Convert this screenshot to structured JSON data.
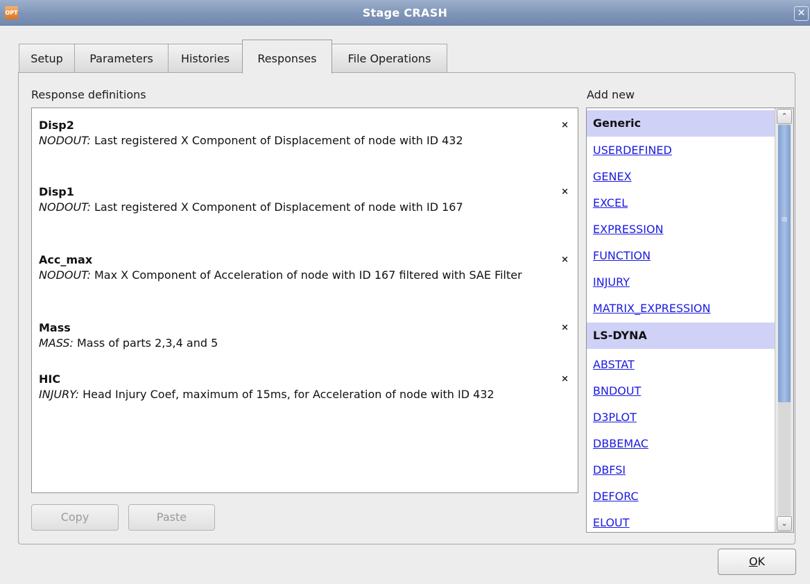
{
  "window": {
    "title": "Stage CRASH",
    "app_icon_text": "OPT",
    "close_symbol": "✕"
  },
  "tabs": [
    {
      "label": "Setup",
      "active": false
    },
    {
      "label": "Parameters",
      "active": false
    },
    {
      "label": "Histories",
      "active": false
    },
    {
      "label": "Responses",
      "active": true
    },
    {
      "label": "File Operations",
      "active": false
    }
  ],
  "responses": {
    "label": "Response definitions",
    "delete_symbol": "×",
    "items": [
      {
        "name": "Disp2",
        "source": "NODOUT:",
        "description": "Last registered X Component of Displacement of node with ID 432"
      },
      {
        "name": "Disp1",
        "source": "NODOUT:",
        "description": "Last registered X Component of Displacement of node with ID 167"
      },
      {
        "name": "Acc_max",
        "source": "NODOUT:",
        "description": "Max X Component of Acceleration of node with ID 167 filtered with SAE Filter"
      },
      {
        "name": "Mass",
        "source": "MASS:",
        "description": "Mass of parts 2,3,4 and 5"
      },
      {
        "name": "HIC",
        "source": "INJURY:",
        "description": "Head Injury Coef, maximum of 15ms, for Acceleration of node with ID 432"
      }
    ],
    "copy_label": "Copy",
    "paste_label": "Paste"
  },
  "add_new": {
    "label": "Add new",
    "rows": [
      {
        "text": "Generic",
        "kind": "header"
      },
      {
        "text": "USERDEFINED",
        "kind": "link"
      },
      {
        "text": "GENEX",
        "kind": "link"
      },
      {
        "text": "EXCEL",
        "kind": "link"
      },
      {
        "text": "EXPRESSION",
        "kind": "link"
      },
      {
        "text": "FUNCTION",
        "kind": "link"
      },
      {
        "text": "INJURY",
        "kind": "link"
      },
      {
        "text": "MATRIX_EXPRESSION",
        "kind": "link"
      },
      {
        "text": "LS-DYNA",
        "kind": "header"
      },
      {
        "text": "ABSTAT",
        "kind": "link"
      },
      {
        "text": "BNDOUT",
        "kind": "link"
      },
      {
        "text": "D3PLOT",
        "kind": "link"
      },
      {
        "text": "DBBEMAC",
        "kind": "link"
      },
      {
        "text": "DBFSI",
        "kind": "link"
      },
      {
        "text": "DEFORC",
        "kind": "link"
      },
      {
        "text": "ELOUT",
        "kind": "link"
      }
    ],
    "scroll": {
      "up_symbol": "⌃",
      "down_symbol": "⌄",
      "grip_symbol": "≡",
      "position": 0
    }
  },
  "ok_label_underlined": "O",
  "ok_label_rest": "K",
  "colors": {
    "header_bg": "#cfd1f7",
    "link": "#1a1ae0",
    "titlebar": "#8397ba"
  }
}
